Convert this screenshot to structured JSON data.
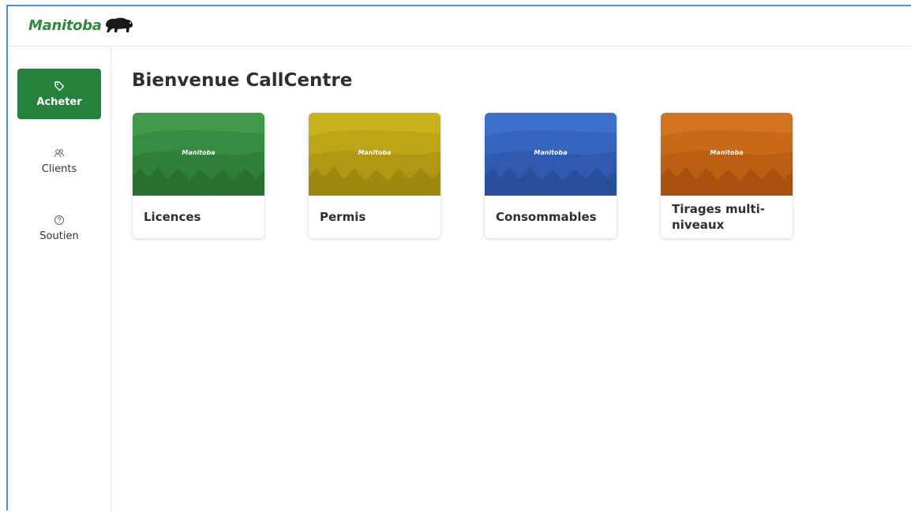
{
  "app": {
    "logo_text": "Manitoba"
  },
  "sidebar": {
    "items": [
      {
        "label": "Acheter",
        "icon": "tag-icon",
        "active": true
      },
      {
        "label": "Clients",
        "icon": "users-icon",
        "active": false
      },
      {
        "label": "Soutien",
        "icon": "help-circle-icon",
        "active": false
      }
    ]
  },
  "main": {
    "title": "Bienvenue CallCentre",
    "cards": [
      {
        "label": "Licences",
        "color": "#3f9a4a",
        "logo": "Manitoba"
      },
      {
        "label": "Permis",
        "color": "#c9b21c",
        "logo": "Manitoba"
      },
      {
        "label": "Consommables",
        "color": "#3d6fcc",
        "logo": "Manitoba"
      },
      {
        "label": "Tirages multi-niveaux",
        "color": "#d4731e",
        "logo": "Manitoba"
      }
    ]
  },
  "colors": {
    "brand_green": "#2e8b3a",
    "active_nav": "#25823a",
    "frame_border": "#4a90d9"
  }
}
